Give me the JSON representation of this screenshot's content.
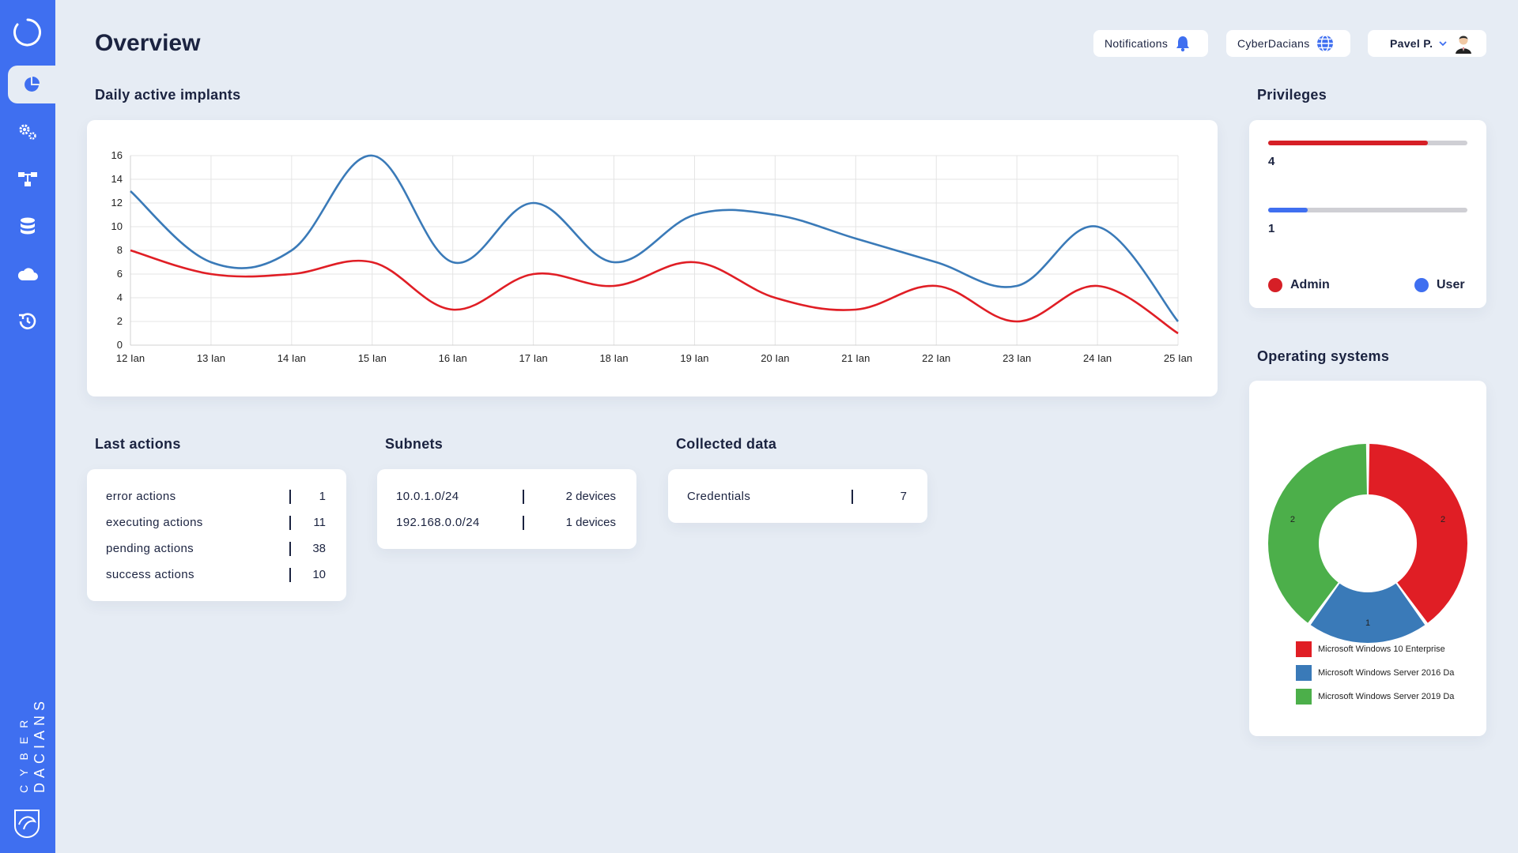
{
  "page": {
    "title": "Overview"
  },
  "header": {
    "notifications_label": "Notifications",
    "workspace_label": "CyberDacians",
    "user_name": "Pavel P."
  },
  "sidebar": {
    "items": [
      {
        "name": "dashboard",
        "icon": "pie-chart-icon",
        "active": true
      },
      {
        "name": "settings",
        "icon": "gears-icon",
        "active": false
      },
      {
        "name": "network",
        "icon": "network-tree-icon",
        "active": false
      },
      {
        "name": "database",
        "icon": "database-icon",
        "active": false
      },
      {
        "name": "cloud",
        "icon": "cloud-icon",
        "active": false
      },
      {
        "name": "history",
        "icon": "history-icon",
        "active": false
      }
    ],
    "brand_line1": "CYBER",
    "brand_line2": "DACIANS"
  },
  "colors": {
    "sidebar": "#3f6ff0",
    "admin": "#d61f26",
    "user": "#3f6ff0",
    "blue_series": "#3a7ab8",
    "red_series": "#e01e25",
    "green": "#4caf4a"
  },
  "daily": {
    "title": "Daily active implants",
    "chart_data": {
      "type": "line",
      "categories": [
        "12 Ian",
        "13 Ian",
        "14 Ian",
        "15 Ian",
        "16 Ian",
        "17 Ian",
        "18 Ian",
        "19 Ian",
        "20 Ian",
        "21 Ian",
        "22 Ian",
        "23 Ian",
        "24 Ian",
        "25 Ian"
      ],
      "series": [
        {
          "color": "#3a7ab8",
          "values": [
            13,
            7,
            8,
            16,
            7,
            12,
            7,
            11,
            11,
            9,
            7,
            5,
            10,
            2
          ]
        },
        {
          "color": "#e01e25",
          "values": [
            8,
            6,
            6,
            7,
            3,
            6,
            5,
            7,
            4,
            3,
            5,
            2,
            5,
            1
          ]
        }
      ],
      "yticks": [
        "0",
        "2",
        "4",
        "6",
        "8",
        "10",
        "12",
        "14",
        "16"
      ],
      "ylim": [
        0,
        16
      ],
      "grid": true
    }
  },
  "last_actions": {
    "title": "Last actions",
    "rows": [
      {
        "label": "error actions",
        "value": "1"
      },
      {
        "label": "executing actions",
        "value": "11"
      },
      {
        "label": "pending actions",
        "value": "38"
      },
      {
        "label": "success actions",
        "value": "10"
      }
    ]
  },
  "subnets": {
    "title": "Subnets",
    "rows": [
      {
        "label": "10.0.1.0/24",
        "value": "2 devices"
      },
      {
        "label": "192.168.0.0/24",
        "value": "1 devices"
      }
    ]
  },
  "collected": {
    "title": "Collected data",
    "rows": [
      {
        "label": "Credentials",
        "value": "7"
      }
    ]
  },
  "privileges": {
    "title": "Privileges",
    "admin_count": "4",
    "admin_fill": 0.8,
    "user_count": "1",
    "user_fill": 0.2,
    "admin_label": "Admin",
    "user_label": "User"
  },
  "os": {
    "title": "Operating systems",
    "chart_data": {
      "type": "pie",
      "labels": [
        "Microsoft Windows 10 Enterprise",
        "Microsoft Windows Server 2016 Da",
        "Microsoft Windows Server 2019 Da"
      ],
      "values": [
        2,
        1,
        2
      ],
      "colors": [
        "#e01e25",
        "#3a7ab8",
        "#4caf4a"
      ]
    },
    "slice_labels": [
      "2",
      "1",
      "2"
    ]
  }
}
